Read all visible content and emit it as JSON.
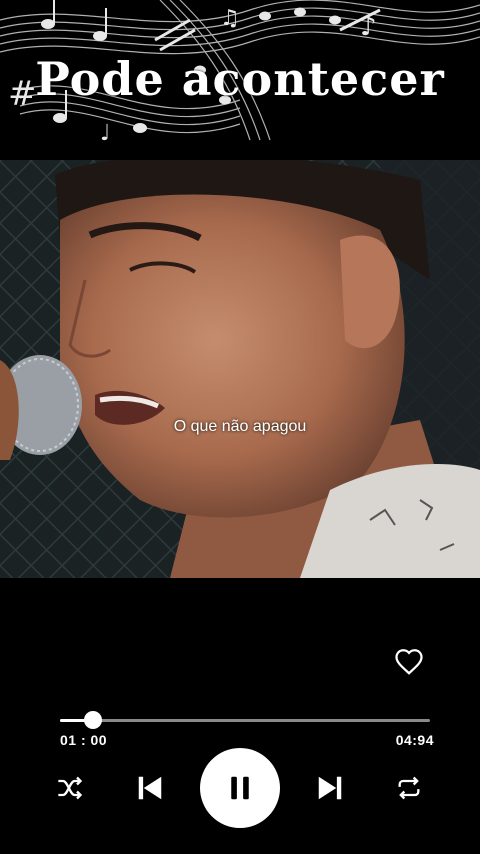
{
  "header": {
    "title": "Pode acontecer"
  },
  "video": {
    "lyric": "O que não apagou"
  },
  "player": {
    "elapsed": "01 : 00",
    "total": "04:94",
    "progress": 0.09,
    "icons": {
      "like": "heart-icon",
      "shuffle": "shuffle-icon",
      "previous": "skip-previous-icon",
      "pause": "pause-icon",
      "next": "skip-next-icon",
      "repeat": "repeat-icon"
    },
    "colors": {
      "background": "#000000",
      "accent": "#ffffff",
      "track": "#8a8a8a"
    }
  }
}
